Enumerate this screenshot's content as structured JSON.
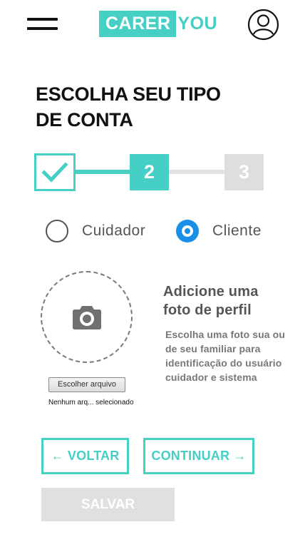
{
  "header": {
    "logo_part1": "CARER",
    "logo_part2": "YOU",
    "menu_icon": "hamburger-menu-icon",
    "profile_icon": "user-circle-icon"
  },
  "title": {
    "line1": "ESCOLHA SEU TIPO",
    "line2": "DE CONTA"
  },
  "stepper": {
    "steps": [
      {
        "label": "",
        "state": "completed",
        "icon": "checkmark-icon"
      },
      {
        "label": "2",
        "state": "active"
      },
      {
        "label": "3",
        "state": "inactive"
      }
    ]
  },
  "account_type": {
    "options": [
      {
        "label": "Cuidador",
        "checked": false
      },
      {
        "label": "Cliente",
        "checked": true
      }
    ]
  },
  "photo": {
    "icon": "camera-icon",
    "file_button": "Escolher arquivo",
    "file_status": "Nenhum arq... selecionado",
    "heading": "Adicione uma foto de perfil",
    "description": "Escolha uma foto sua ou de seu familiar para identificação do usuário cuidador e sistema"
  },
  "actions": {
    "back": "← VOLTAR",
    "continue": "CONTINUAR →",
    "save": "SALVAR"
  },
  "colors": {
    "brand": "#45cfc5",
    "radio_selected": "#1a8fe8",
    "disabled": "#e0e0e0"
  }
}
